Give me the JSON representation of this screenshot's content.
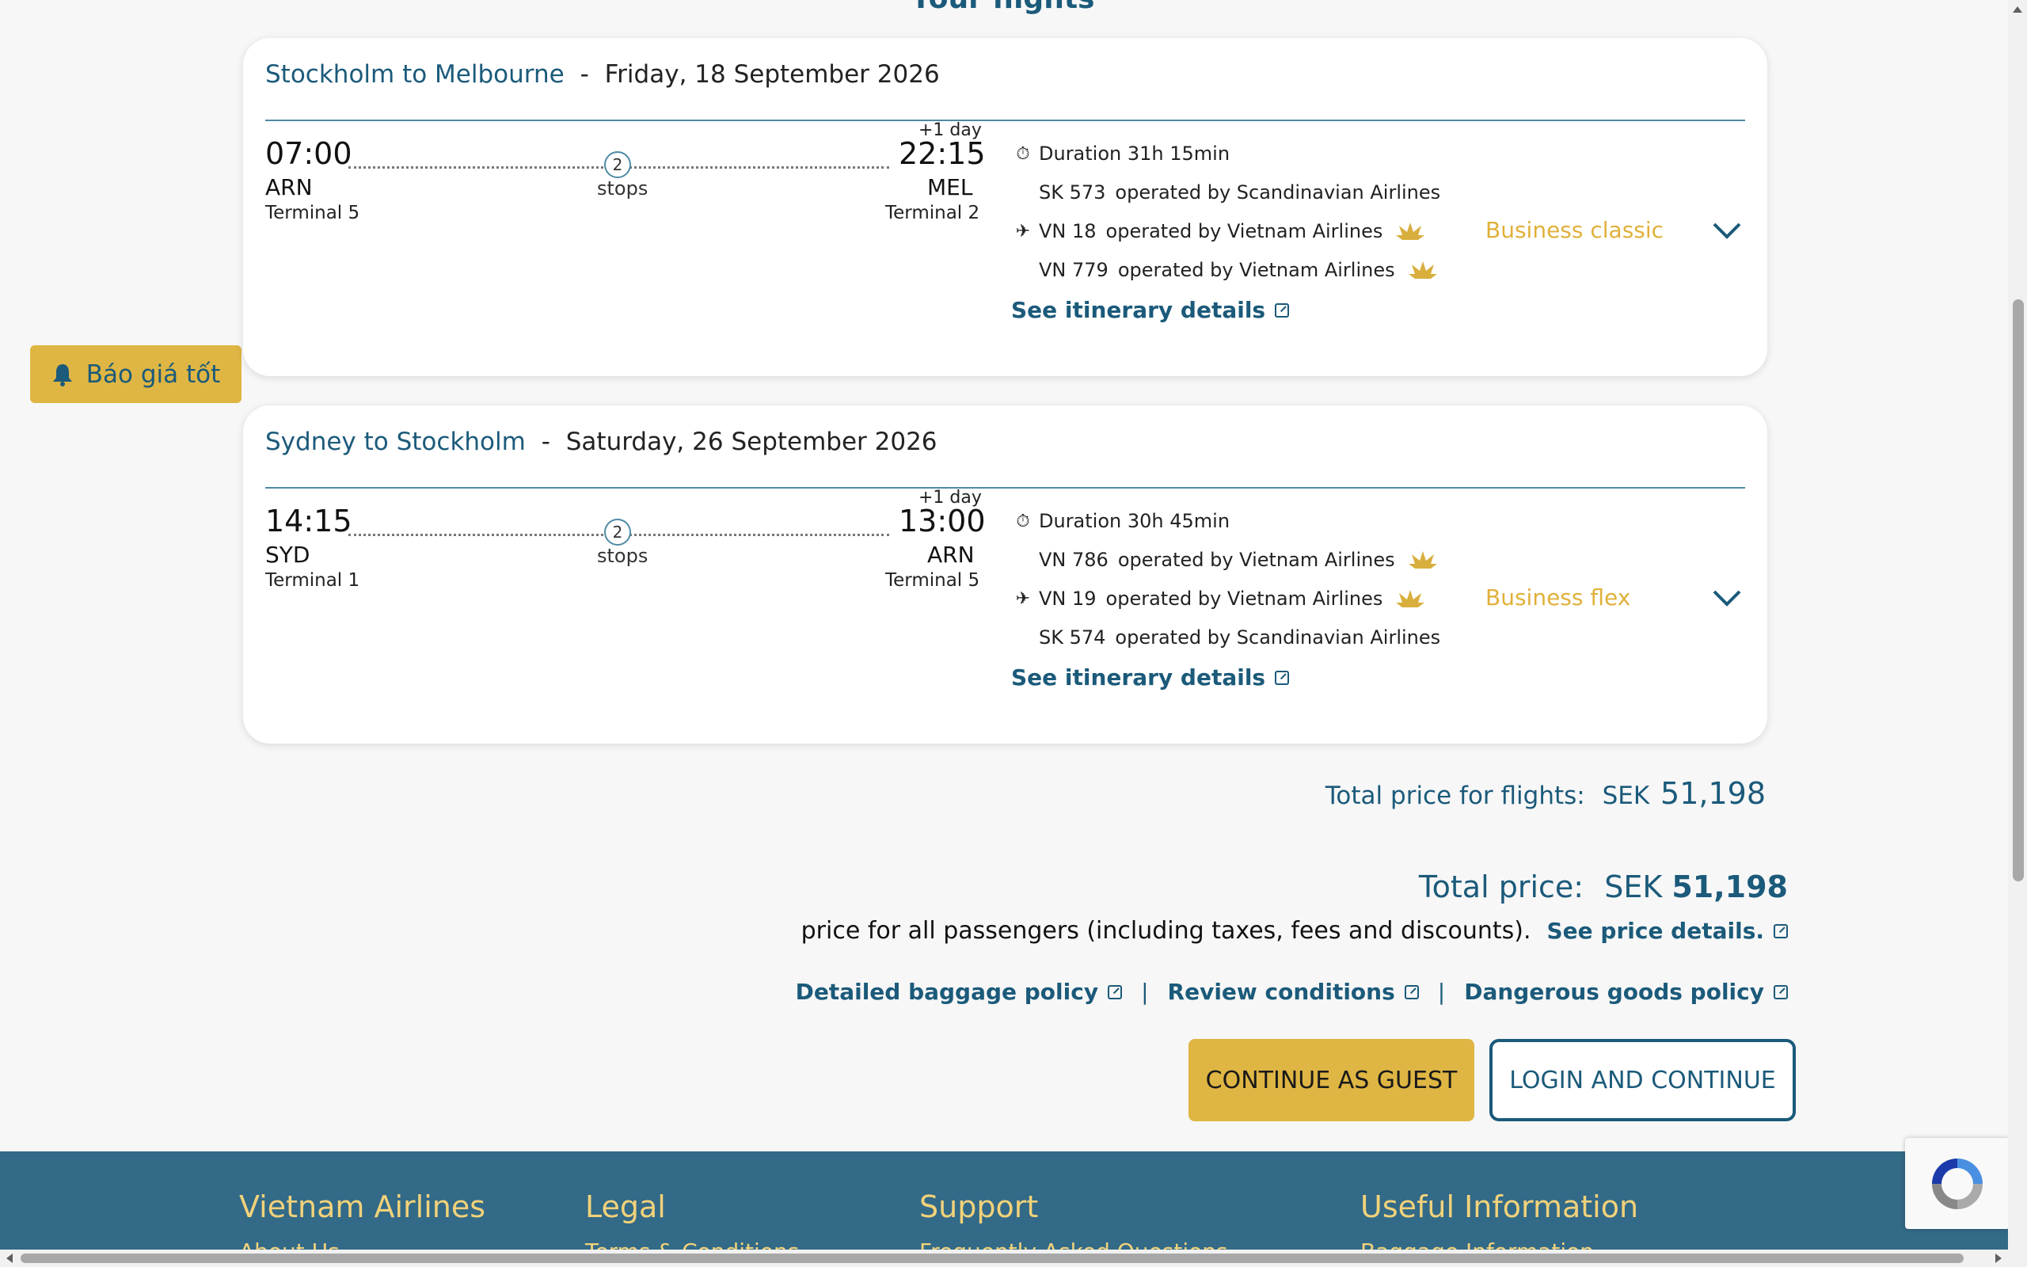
{
  "page": {
    "heading": "Your flights"
  },
  "alert_button": {
    "label": "Báo giá tốt",
    "icon": "bell-icon"
  },
  "flights": [
    {
      "route": "Stockholm to Melbourne",
      "separator": "-",
      "date": "Friday, 18 September 2026",
      "depart_time": "07:00",
      "depart_code": "ARN",
      "depart_terminal": "Terminal 5",
      "arrive_time": "22:15",
      "arrive_code": "MEL",
      "arrive_terminal": "Terminal 2",
      "plus_day": "+1 day",
      "stops_count": "2",
      "stops_label": "stops",
      "duration": "Duration 31h 15min",
      "segments": [
        {
          "flight": "SK 573",
          "operated": "operated by Scandinavian Airlines",
          "lotus": false,
          "plane": false
        },
        {
          "flight": "VN 18",
          "operated": "operated by Vietnam Airlines",
          "lotus": true,
          "plane": true
        },
        {
          "flight": "VN 779",
          "operated": "operated by Vietnam Airlines",
          "lotus": true,
          "plane": false
        }
      ],
      "itinerary_link": "See itinerary details",
      "fare": "Business classic"
    },
    {
      "route": "Sydney to Stockholm",
      "separator": "-",
      "date": "Saturday, 26 September 2026",
      "depart_time": "14:15",
      "depart_code": "SYD",
      "depart_terminal": "Terminal 1",
      "arrive_time": "13:00",
      "arrive_code": "ARN",
      "arrive_terminal": "Terminal 5",
      "plus_day": "+1 day",
      "stops_count": "2",
      "stops_label": "stops",
      "duration": "Duration 30h 45min",
      "segments": [
        {
          "flight": "VN 786",
          "operated": "operated by Vietnam Airlines",
          "lotus": true,
          "plane": false
        },
        {
          "flight": "VN 19",
          "operated": "operated by Vietnam Airlines",
          "lotus": true,
          "plane": true
        },
        {
          "flight": "SK 574",
          "operated": "operated by Scandinavian Airlines",
          "lotus": false,
          "plane": false
        }
      ],
      "itinerary_link": "See itinerary details",
      "fare": "Business flex"
    }
  ],
  "summary": {
    "flights_total_label": "Total price for flights:",
    "flights_total_currency": "SEK",
    "flights_total_amount": "51,198",
    "total_label": "Total price:",
    "total_currency": "SEK",
    "total_amount": "51,198",
    "note": "price for all passengers (including taxes, fees and discounts).",
    "price_details_link": "See price details."
  },
  "policy_links": {
    "baggage": "Detailed baggage policy",
    "conditions": "Review conditions",
    "dangerous_goods": "Dangerous goods policy",
    "separator": "|"
  },
  "buttons": {
    "guest": "CONTINUE AS GUEST",
    "login": "LOGIN AND CONTINUE"
  },
  "footer": {
    "columns": [
      {
        "title": "Vietnam Airlines",
        "first_item": "About Us"
      },
      {
        "title": "Legal",
        "first_item": "Terms & Conditions"
      },
      {
        "title": "Support",
        "first_item": "Frequently Asked Questions"
      },
      {
        "title": "Useful Information",
        "first_item": "Baggage Information"
      }
    ]
  },
  "colors": {
    "primary": "#1b5a7a",
    "accent_gold": "#dfb643",
    "fare_gold": "#e0b13a",
    "footer_bg": "#336a87",
    "footer_text": "#f2d27a"
  }
}
